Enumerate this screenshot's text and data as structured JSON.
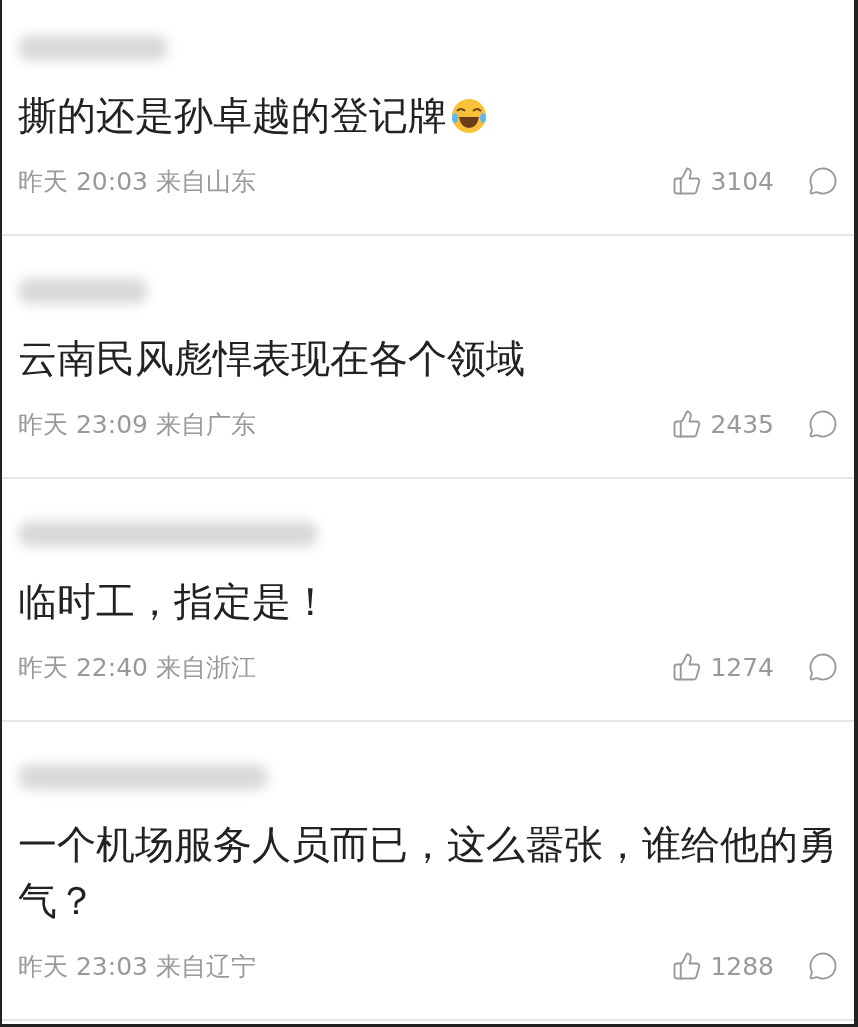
{
  "comments": [
    {
      "text": "撕的还是孙卓越的登记牌",
      "emoji": true,
      "time": "昨天 20:03",
      "location": "来自山东",
      "likes": "3104"
    },
    {
      "text": "云南民风彪悍表现在各个领域",
      "emoji": false,
      "time": "昨天 23:09",
      "location": "来自广东",
      "likes": "2435"
    },
    {
      "text": "临时工，指定是！",
      "emoji": false,
      "time": "昨天 22:40",
      "location": "来自浙江",
      "likes": "1274"
    },
    {
      "text": "一个机场服务人员而已，这么嚣张，谁给他的勇气？",
      "emoji": false,
      "time": "昨天 23:03",
      "location": "来自辽宁",
      "likes": "1288"
    }
  ]
}
